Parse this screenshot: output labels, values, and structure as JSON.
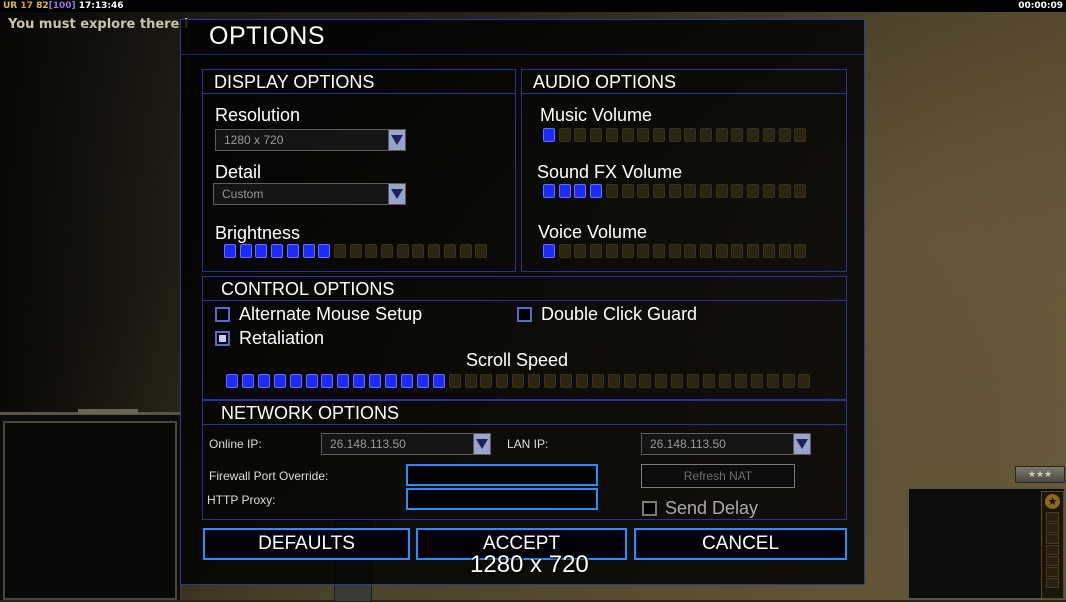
{
  "hud": {
    "rank_abbrev": "UR",
    "stat1": "17",
    "stat2": "82",
    "stat3": "[100]",
    "time": "17:13:46",
    "game_timer": "00:00:09",
    "message": "You must explore there before b"
  },
  "dialog": {
    "title": "OPTIONS",
    "display": {
      "header": "DISPLAY OPTIONS",
      "resolution_label": "Resolution",
      "resolution_value": "1280 x 720",
      "detail_label": "Detail",
      "detail_value": "Custom",
      "brightness_label": "Brightness",
      "brightness_level": 7,
      "brightness_total": 17
    },
    "audio": {
      "header": "AUDIO OPTIONS",
      "music_label": "Music Volume",
      "music_level": 1,
      "sfx_label": "Sound FX Volume",
      "sfx_level": 4,
      "voice_label": "Voice Volume",
      "voice_level": 1,
      "total": 17
    },
    "control": {
      "header": "CONTROL OPTIONS",
      "alt_mouse_label": "Alternate Mouse Setup",
      "alt_mouse_checked": false,
      "double_click_label": "Double Click Guard",
      "double_click_checked": false,
      "retaliation_label": "Retaliation",
      "retaliation_checked": true,
      "scroll_label": "Scroll Speed",
      "scroll_level": 14,
      "scroll_total": 37
    },
    "network": {
      "header": "NETWORK OPTIONS",
      "online_ip_label": "Online IP:",
      "online_ip_value": "26.148.113.50",
      "lan_ip_label": "LAN IP:",
      "lan_ip_value": "26.148.113.50",
      "firewall_label": "Firewall Port Override:",
      "firewall_value": "",
      "http_proxy_label": "HTTP Proxy:",
      "http_proxy_value": "",
      "refresh_nat_label": "Refresh NAT",
      "send_delay_label": "Send Delay",
      "send_delay_checked": false
    },
    "buttons": {
      "defaults": "DEFAULTS",
      "accept": "ACCEPT",
      "cancel": "CANCEL"
    },
    "tooltip": "1280 x 720"
  },
  "colors": {
    "accent_blue": "#2a8cff",
    "slider_on": "#1c2cff",
    "border": "#2a3490"
  }
}
